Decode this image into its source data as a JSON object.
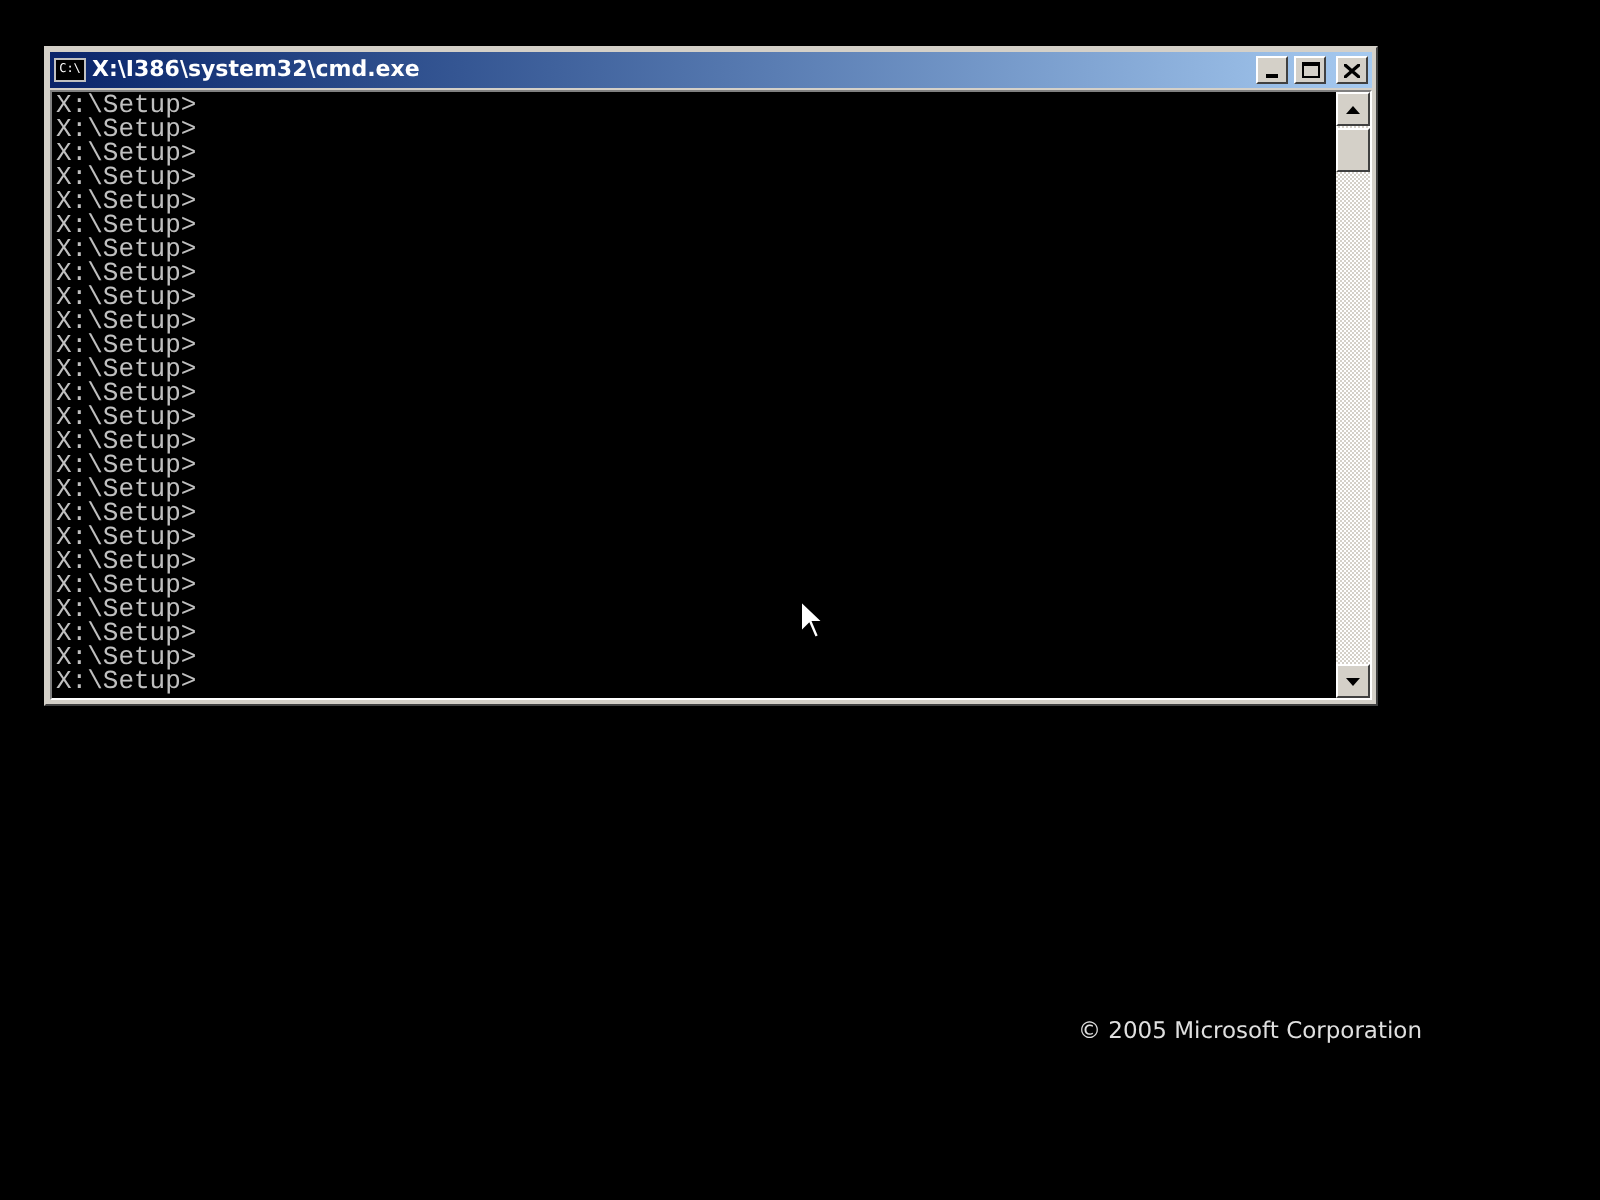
{
  "background": {
    "copyright": "© 2005 Microsoft Corporation"
  },
  "window": {
    "title": "X:\\I386\\system32\\cmd.exe",
    "icon_text": "C:\\",
    "lines": [
      "X:\\Setup>",
      "X:\\Setup>",
      "X:\\Setup>",
      "X:\\Setup>",
      "X:\\Setup>",
      "X:\\Setup>",
      "X:\\Setup>",
      "X:\\Setup>",
      "X:\\Setup>",
      "X:\\Setup>",
      "X:\\Setup>",
      "X:\\Setup>",
      "X:\\Setup>",
      "X:\\Setup>",
      "X:\\Setup>",
      "X:\\Setup>",
      "X:\\Setup>",
      "X:\\Setup>",
      "X:\\Setup>",
      "X:\\Setup>",
      "X:\\Setup>",
      "X:\\Setup>",
      "X:\\Setup>",
      "X:\\Setup>",
      "X:\\Setup>"
    ]
  }
}
